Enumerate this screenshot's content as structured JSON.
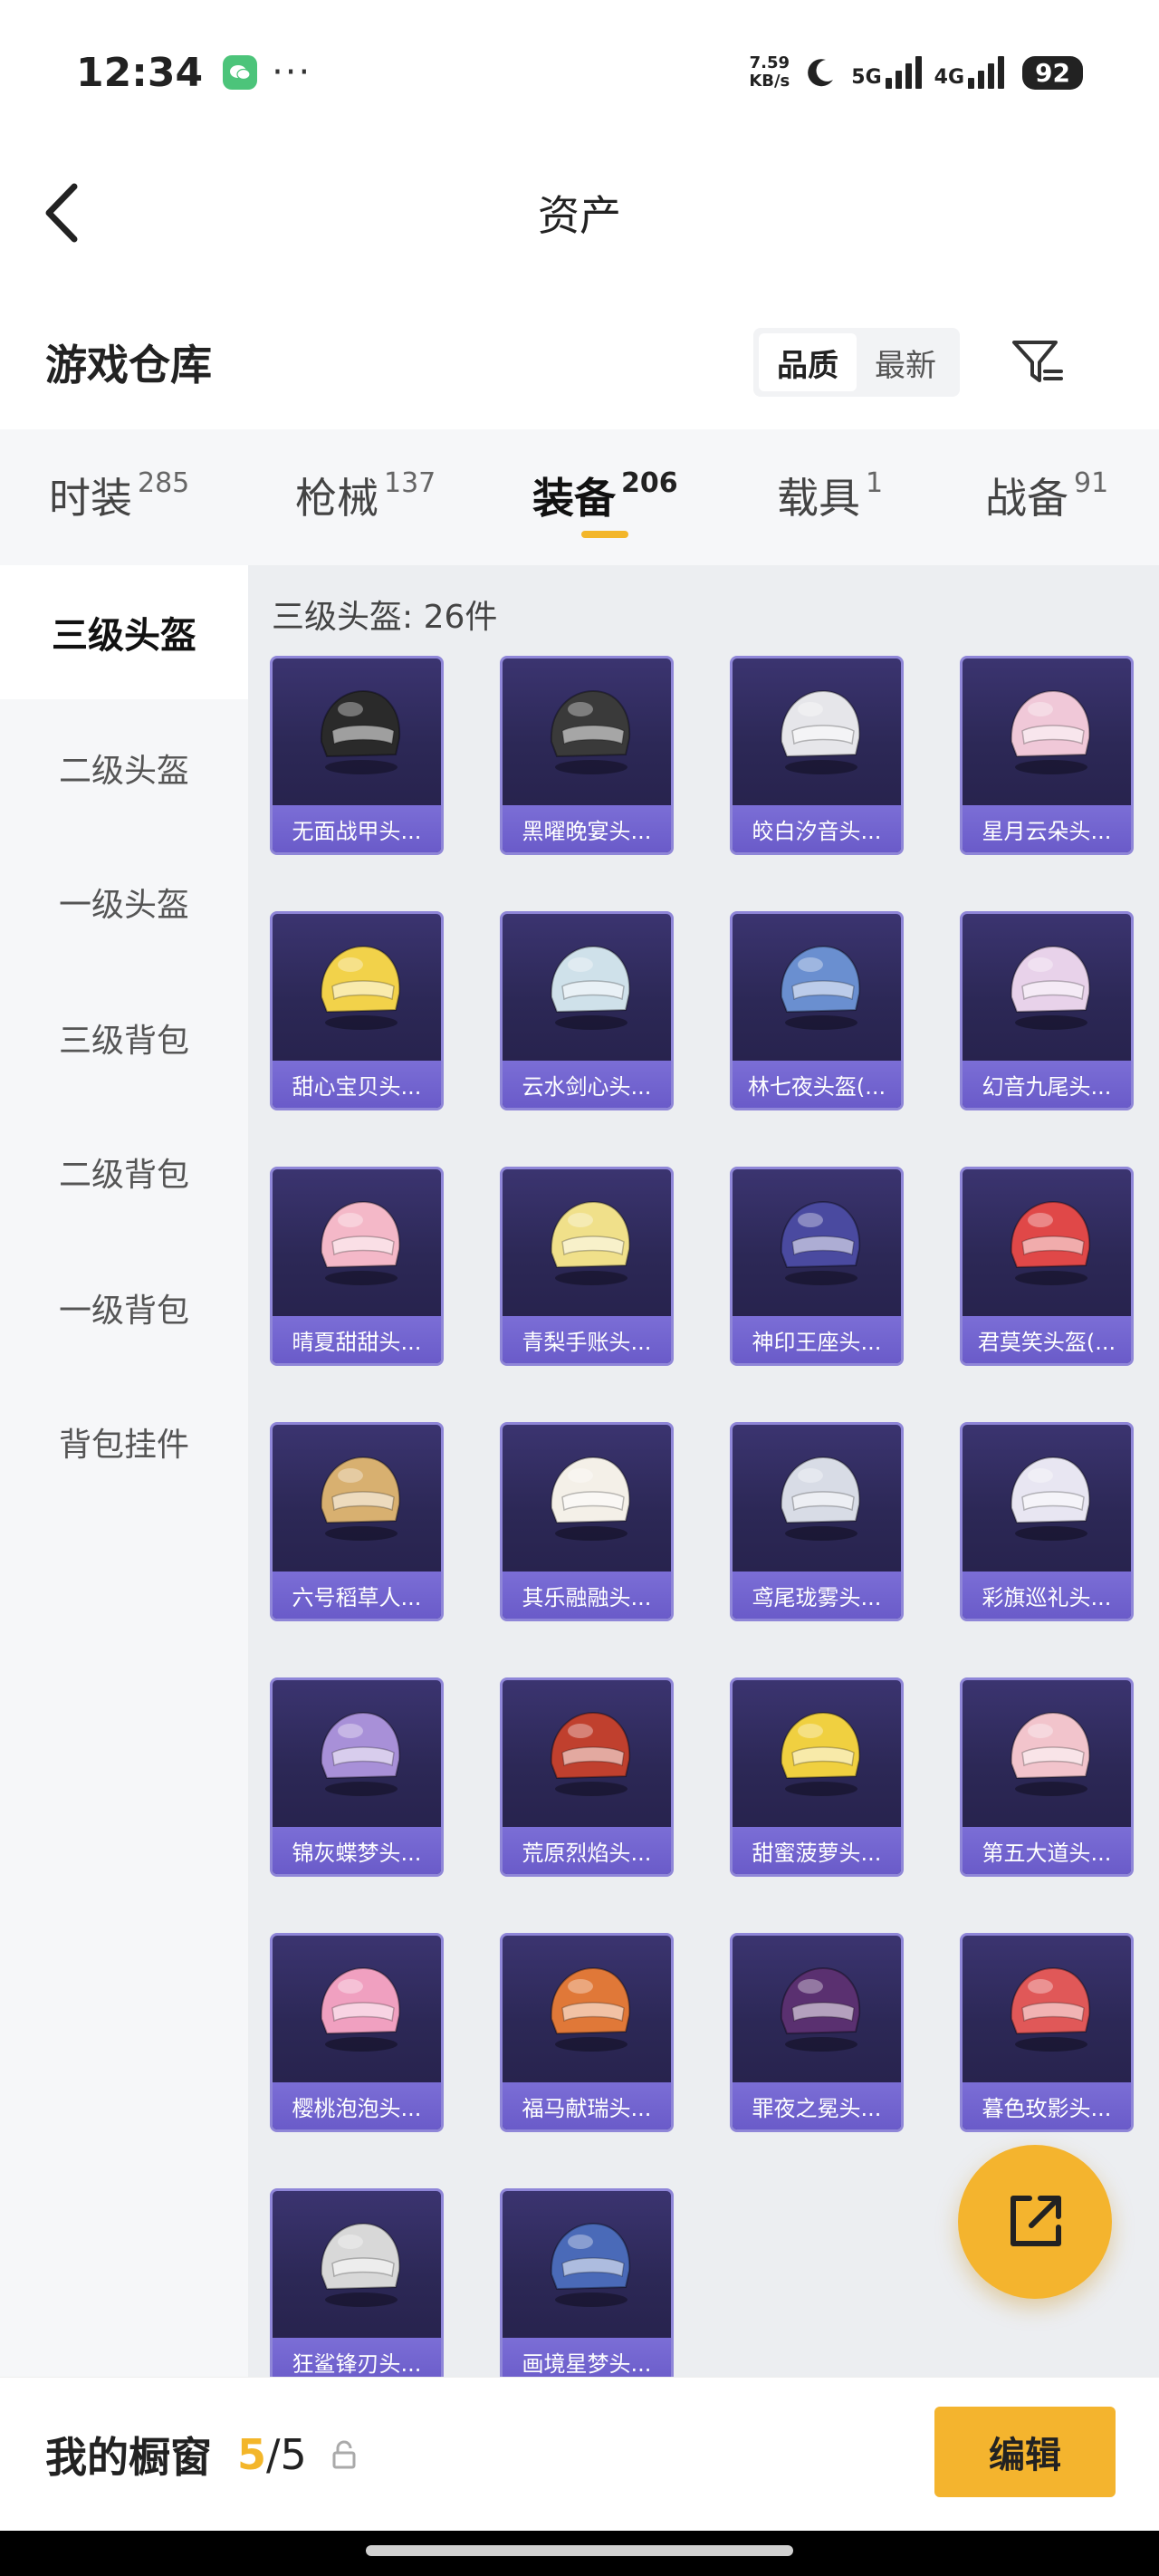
{
  "status_bar": {
    "time": "12:34",
    "net_speed_value": "7.59",
    "net_speed_unit": "KB/s",
    "sig1": "5G",
    "sig2": "4G",
    "battery": "92"
  },
  "header": {
    "title": "资产"
  },
  "warehouse": {
    "title": "游戏仓库",
    "sort_options": [
      "品质",
      "最新"
    ],
    "sort_active": "品质"
  },
  "category_tabs": [
    {
      "label": "时装",
      "count": "285"
    },
    {
      "label": "枪械",
      "count": "137"
    },
    {
      "label": "装备",
      "count": "206",
      "active": true
    },
    {
      "label": "载具",
      "count": "1"
    },
    {
      "label": "战备",
      "count": "91"
    }
  ],
  "sidebar": {
    "items": [
      "三级头盔",
      "二级头盔",
      "一级头盔",
      "三级背包",
      "二级背包",
      "一级背包",
      "背包挂件"
    ],
    "active": "三级头盔"
  },
  "content": {
    "section_title": "三级头盔: 26件",
    "items": [
      {
        "name": "无面战甲头...",
        "icon": "helmet-icon",
        "color": "#2a2a2a"
      },
      {
        "name": "黑曜晚宴头...",
        "icon": "helmet-icon",
        "color": "#3a3a3a"
      },
      {
        "name": "皎白汐音头...",
        "icon": "helmet-icon",
        "color": "#e6e6ea"
      },
      {
        "name": "星月云朵头...",
        "icon": "helmet-icon",
        "color": "#f0c8d8"
      },
      {
        "name": "甜心宝贝头...",
        "icon": "helmet-icon",
        "color": "#f2d24a"
      },
      {
        "name": "云水剑心头...",
        "icon": "helmet-icon",
        "color": "#cfe1ea"
      },
      {
        "name": "林七夜头盔(...",
        "icon": "helmet-icon",
        "color": "#6a8fd0"
      },
      {
        "name": "幻音九尾头...",
        "icon": "helmet-icon",
        "color": "#e8d2ea"
      },
      {
        "name": "晴夏甜甜头...",
        "icon": "helmet-icon",
        "color": "#f4b8c8"
      },
      {
        "name": "青梨手账头...",
        "icon": "helmet-icon",
        "color": "#f0e08a"
      },
      {
        "name": "神印王座头...",
        "icon": "helmet-icon",
        "color": "#4a4aa0"
      },
      {
        "name": "君莫笑头盔(...",
        "icon": "helmet-icon",
        "color": "#e04848"
      },
      {
        "name": "六号稻草人...",
        "icon": "helmet-icon",
        "color": "#d8b070"
      },
      {
        "name": "其乐融融头...",
        "icon": "helmet-icon",
        "color": "#f4f0e8"
      },
      {
        "name": "鸢尾珑雾头...",
        "icon": "helmet-icon",
        "color": "#d8dce6"
      },
      {
        "name": "彩旗巡礼头...",
        "icon": "helmet-icon",
        "color": "#e8e6f2"
      },
      {
        "name": "锦灰蝶梦头...",
        "icon": "helmet-icon",
        "color": "#a890d8"
      },
      {
        "name": "荒原烈焰头...",
        "icon": "helmet-icon",
        "color": "#c0402e"
      },
      {
        "name": "甜蜜菠萝头...",
        "icon": "helmet-icon",
        "color": "#f0d040"
      },
      {
        "name": "第五大道头...",
        "icon": "helmet-icon",
        "color": "#f2c4cc"
      },
      {
        "name": "樱桃泡泡头...",
        "icon": "helmet-icon",
        "color": "#f0a0c0"
      },
      {
        "name": "福马献瑞头...",
        "icon": "helmet-icon",
        "color": "#e07838"
      },
      {
        "name": "罪夜之冕头...",
        "icon": "helmet-icon",
        "color": "#5a3070"
      },
      {
        "name": "暮色玫影头...",
        "icon": "helmet-icon",
        "color": "#e05858"
      },
      {
        "name": "狂鲨锋刃头...",
        "icon": "helmet-icon",
        "color": "#d8d8d8"
      },
      {
        "name": "画境星梦头...",
        "icon": "helmet-icon",
        "color": "#4a6ab8"
      }
    ]
  },
  "bottom_bar": {
    "label": "我的橱窗",
    "current": "5",
    "slash_total": "/5",
    "edit_label": "编辑"
  },
  "colors": {
    "accent": "#f3b62a",
    "card_border": "#8f86d8",
    "card_label": "#6a5bc9"
  }
}
